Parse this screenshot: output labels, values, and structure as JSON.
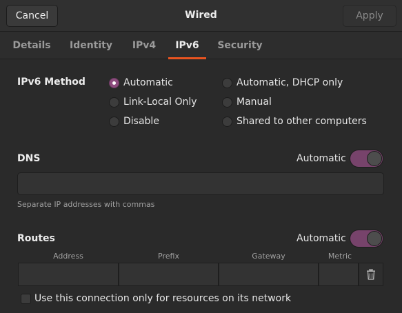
{
  "header": {
    "cancel_label": "Cancel",
    "title": "Wired",
    "apply_label": "Apply"
  },
  "tabs": [
    {
      "label": "Details",
      "active": false
    },
    {
      "label": "Identity",
      "active": false
    },
    {
      "label": "IPv4",
      "active": false
    },
    {
      "label": "IPv6",
      "active": true
    },
    {
      "label": "Security",
      "active": false
    }
  ],
  "ipv6_method": {
    "title": "IPv6 Method",
    "options": [
      {
        "label": "Automatic",
        "checked": true
      },
      {
        "label": "Automatic, DHCP only",
        "checked": false
      },
      {
        "label": "Link-Local Only",
        "checked": false
      },
      {
        "label": "Manual",
        "checked": false
      },
      {
        "label": "Disable",
        "checked": false
      },
      {
        "label": "Shared to other computers",
        "checked": false
      }
    ]
  },
  "dns": {
    "title": "DNS",
    "automatic_label": "Automatic",
    "automatic_on": true,
    "value": "",
    "hint": "Separate IP addresses with commas"
  },
  "routes": {
    "title": "Routes",
    "automatic_label": "Automatic",
    "automatic_on": true,
    "columns": [
      "Address",
      "Prefix",
      "Gateway",
      "Metric"
    ],
    "row": {
      "address": "",
      "prefix": "",
      "gateway": "",
      "metric": ""
    }
  },
  "only_local_label": "Use this connection only for resources on its network",
  "colors": {
    "accent": "#e95420",
    "selected": "#8d4c7e",
    "switch_on": "#77436b"
  }
}
